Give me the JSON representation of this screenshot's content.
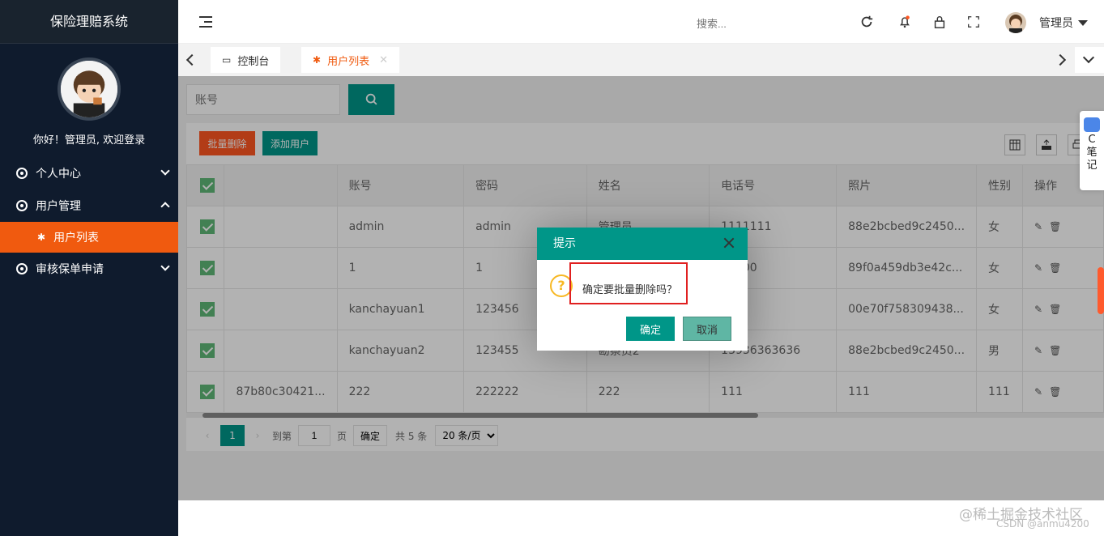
{
  "app_title": "保险理赔系统",
  "sidebar": {
    "welcome": "你好！管理员, 欢迎登录",
    "menu": [
      {
        "label": "个人中心"
      },
      {
        "label": "用户管理"
      },
      {
        "label": "用户列表"
      },
      {
        "label": "审核保单申请"
      }
    ]
  },
  "topbar": {
    "search_placeholder": "搜索...",
    "user_name": "管理员"
  },
  "tabs": [
    {
      "label": "控制台"
    },
    {
      "label": "用户列表"
    }
  ],
  "content": {
    "search_placeholder": "账号",
    "batch_delete": "批量删除",
    "add_user": "添加用户",
    "columns": [
      "",
      "",
      "账号",
      "密码",
      "姓名",
      "电话号",
      "照片",
      "性别",
      "操作"
    ],
    "rows": [
      {
        "id": "",
        "account": "admin",
        "password": "admin",
        "name": "管理员",
        "phone": "1111111",
        "photo": "88e2bcbed9c2450...",
        "gender": "女"
      },
      {
        "id": "",
        "account": "1",
        "password": "1",
        "name": "",
        "phone": "00000",
        "photo": "89f0a459db3e42c...",
        "gender": "女"
      },
      {
        "id": "",
        "account": "kanchayuan1",
        "password": "123456",
        "name": "",
        "phone": "",
        "photo": "00e70f758309438...",
        "gender": "女"
      },
      {
        "id": "",
        "account": "kanchayuan2",
        "password": "123455",
        "name": "勘察员2",
        "phone": "13936363636",
        "photo": "88e2bcbed9c2450...",
        "gender": "男"
      },
      {
        "id": "87b80c30421...",
        "account": "222",
        "password": "222222",
        "name": "222",
        "phone": "111",
        "photo": "111",
        "gender": "111"
      }
    ],
    "pager": {
      "current": "1",
      "goto_label": "到第",
      "goto_value": "1",
      "page_label": "页",
      "confirm": "确定",
      "total": "共 5 条",
      "page_size": "20 条/页"
    }
  },
  "dialog": {
    "title": "提示",
    "message": "确定要批量删除吗？",
    "ok": "确定",
    "cancel": "取消"
  },
  "float_note": {
    "line1": "C",
    "line2": "笔",
    "line3": "记"
  },
  "watermark": {
    "line1": "@稀土掘金技术社区",
    "line2": "CSDN @anmu4200"
  },
  "colors": {
    "accent": "#009688",
    "danger": "#ff5722",
    "sidebar": "#0f1b2d",
    "active": "#f05a0f"
  }
}
